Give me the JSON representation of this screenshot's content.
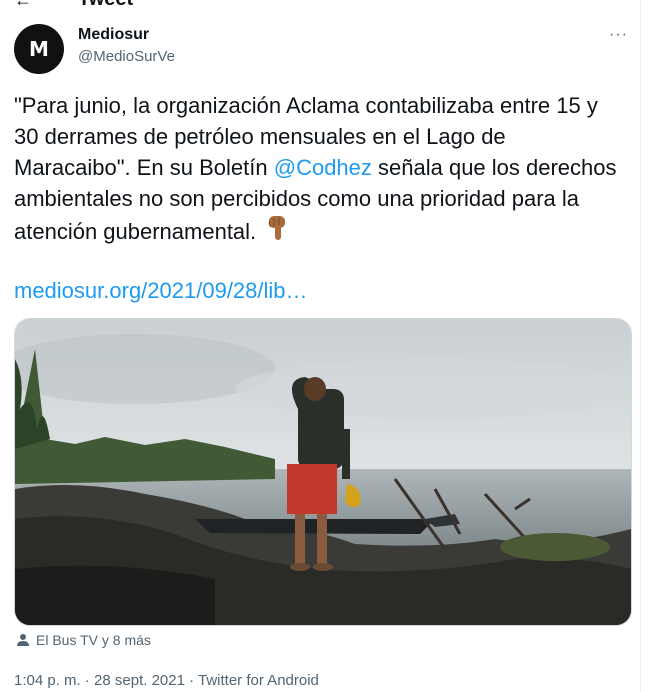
{
  "header": {
    "title": "Tweet"
  },
  "author": {
    "avatar_letter": "M",
    "name": "Mediosur",
    "handle": "@MedioSurVe"
  },
  "menu": {
    "more_label": "···"
  },
  "tweet": {
    "text_before": "\"Para junio, la organización Aclama contabilizaba entre 15 y 30 derrames de petróleo mensuales en el Lago de Maracaibo\". En su Boletín ",
    "mention": "@Codhez",
    "text_after": " señala que los derechos ambientales no son percibidos como una prioridad para la atención gubernamental. ",
    "emoji": "pointing-down-emoji",
    "link": "mediosur.org/2021/09/28/lib…"
  },
  "tags": {
    "text": "El Bus TV y 8 más",
    "icon": "person-icon"
  },
  "meta": {
    "text": "1:04 p. m. · 28 sept. 2021 · Twitter for Android"
  },
  "colors": {
    "link": "#1d9bf0",
    "muted": "#536471",
    "text": "#0f1419"
  }
}
